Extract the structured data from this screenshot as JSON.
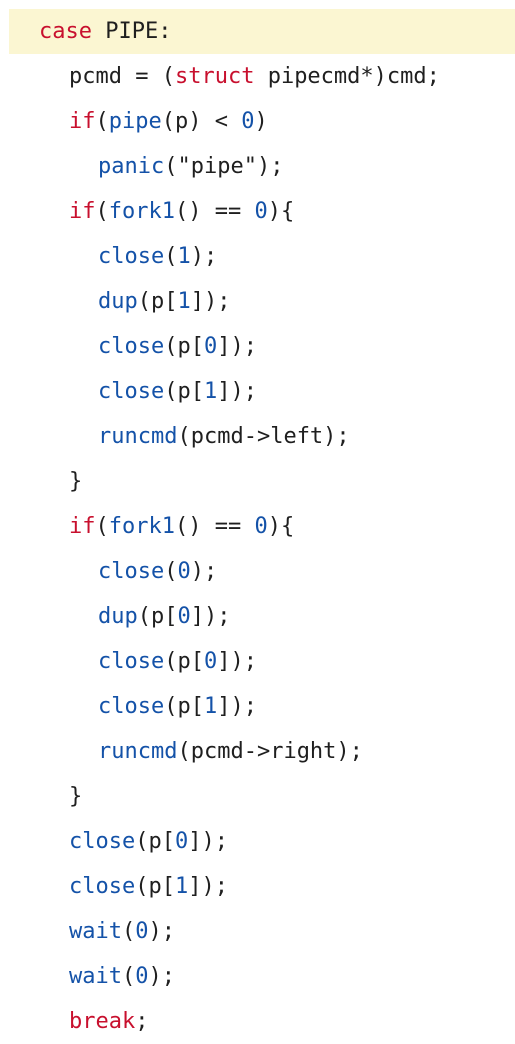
{
  "colors": {
    "keyword": "#c8102e",
    "function": "#1452a8",
    "number": "#1452a8",
    "text": "#1f1f1f",
    "highlight_background": "#fbf6d2"
  },
  "code_lines": [
    {
      "highlighted": true,
      "tokens": [
        {
          "t": "kw",
          "v": "case"
        },
        {
          "t": "plain",
          "v": " PIPE:"
        }
      ]
    },
    {
      "tokens": [
        {
          "t": "plain",
          "v": "pcmd = ("
        },
        {
          "t": "kw",
          "v": "struct"
        },
        {
          "t": "plain",
          "v": " pipecmd*)cmd;"
        }
      ]
    },
    {
      "tokens": [
        {
          "t": "kw",
          "v": "if"
        },
        {
          "t": "plain",
          "v": "("
        },
        {
          "t": "fn",
          "v": "pipe"
        },
        {
          "t": "plain",
          "v": "(p) < "
        },
        {
          "t": "num",
          "v": "0"
        },
        {
          "t": "plain",
          "v": ")"
        }
      ]
    },
    {
      "tokens": [
        {
          "t": "fn",
          "v": "panic"
        },
        {
          "t": "plain",
          "v": "(\"pipe\");"
        }
      ]
    },
    {
      "tokens": [
        {
          "t": "kw",
          "v": "if"
        },
        {
          "t": "plain",
          "v": "("
        },
        {
          "t": "fn",
          "v": "fork1"
        },
        {
          "t": "plain",
          "v": "() == "
        },
        {
          "t": "num",
          "v": "0"
        },
        {
          "t": "plain",
          "v": "){"
        }
      ]
    },
    {
      "tokens": [
        {
          "t": "fn",
          "v": "close"
        },
        {
          "t": "plain",
          "v": "("
        },
        {
          "t": "num",
          "v": "1"
        },
        {
          "t": "plain",
          "v": ");"
        }
      ]
    },
    {
      "tokens": [
        {
          "t": "fn",
          "v": "dup"
        },
        {
          "t": "plain",
          "v": "(p["
        },
        {
          "t": "num",
          "v": "1"
        },
        {
          "t": "plain",
          "v": "]);"
        }
      ]
    },
    {
      "tokens": [
        {
          "t": "fn",
          "v": "close"
        },
        {
          "t": "plain",
          "v": "(p["
        },
        {
          "t": "num",
          "v": "0"
        },
        {
          "t": "plain",
          "v": "]);"
        }
      ]
    },
    {
      "tokens": [
        {
          "t": "fn",
          "v": "close"
        },
        {
          "t": "plain",
          "v": "(p["
        },
        {
          "t": "num",
          "v": "1"
        },
        {
          "t": "plain",
          "v": "]);"
        }
      ]
    },
    {
      "tokens": [
        {
          "t": "fn",
          "v": "runcmd"
        },
        {
          "t": "plain",
          "v": "(pcmd->left);"
        }
      ]
    },
    {
      "tokens": [
        {
          "t": "plain",
          "v": "}"
        }
      ]
    },
    {
      "tokens": [
        {
          "t": "kw",
          "v": "if"
        },
        {
          "t": "plain",
          "v": "("
        },
        {
          "t": "fn",
          "v": "fork1"
        },
        {
          "t": "plain",
          "v": "() == "
        },
        {
          "t": "num",
          "v": "0"
        },
        {
          "t": "plain",
          "v": "){"
        }
      ]
    },
    {
      "tokens": [
        {
          "t": "fn",
          "v": "close"
        },
        {
          "t": "plain",
          "v": "("
        },
        {
          "t": "num",
          "v": "0"
        },
        {
          "t": "plain",
          "v": ");"
        }
      ]
    },
    {
      "tokens": [
        {
          "t": "fn",
          "v": "dup"
        },
        {
          "t": "plain",
          "v": "(p["
        },
        {
          "t": "num",
          "v": "0"
        },
        {
          "t": "plain",
          "v": "]);"
        }
      ]
    },
    {
      "tokens": [
        {
          "t": "fn",
          "v": "close"
        },
        {
          "t": "plain",
          "v": "(p["
        },
        {
          "t": "num",
          "v": "0"
        },
        {
          "t": "plain",
          "v": "]);"
        }
      ]
    },
    {
      "tokens": [
        {
          "t": "fn",
          "v": "close"
        },
        {
          "t": "plain",
          "v": "(p["
        },
        {
          "t": "num",
          "v": "1"
        },
        {
          "t": "plain",
          "v": "]);"
        }
      ]
    },
    {
      "tokens": [
        {
          "t": "fn",
          "v": "runcmd"
        },
        {
          "t": "plain",
          "v": "(pcmd->right);"
        }
      ]
    },
    {
      "tokens": [
        {
          "t": "plain",
          "v": "}"
        }
      ]
    },
    {
      "tokens": [
        {
          "t": "fn",
          "v": "close"
        },
        {
          "t": "plain",
          "v": "(p["
        },
        {
          "t": "num",
          "v": "0"
        },
        {
          "t": "plain",
          "v": "]);"
        }
      ]
    },
    {
      "tokens": [
        {
          "t": "fn",
          "v": "close"
        },
        {
          "t": "plain",
          "v": "(p["
        },
        {
          "t": "num",
          "v": "1"
        },
        {
          "t": "plain",
          "v": "]);"
        }
      ]
    },
    {
      "tokens": [
        {
          "t": "fn",
          "v": "wait"
        },
        {
          "t": "plain",
          "v": "("
        },
        {
          "t": "num",
          "v": "0"
        },
        {
          "t": "plain",
          "v": ");"
        }
      ]
    },
    {
      "tokens": [
        {
          "t": "fn",
          "v": "wait"
        },
        {
          "t": "plain",
          "v": "("
        },
        {
          "t": "num",
          "v": "0"
        },
        {
          "t": "plain",
          "v": ");"
        }
      ]
    },
    {
      "tokens": [
        {
          "t": "kw",
          "v": "break"
        },
        {
          "t": "plain",
          "v": ";"
        }
      ]
    }
  ]
}
